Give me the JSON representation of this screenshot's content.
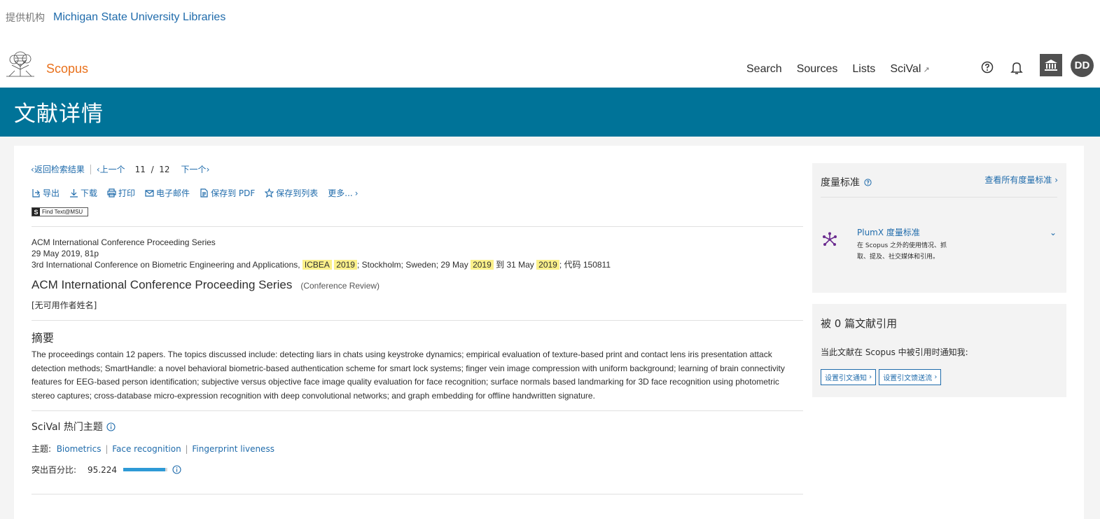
{
  "institution": {
    "label": "提供机构",
    "name": "Michigan State University Libraries"
  },
  "header": {
    "brand": "Scopus",
    "nav": [
      "Search",
      "Sources",
      "Lists",
      "SciVal"
    ],
    "nav_external_mark": "↗",
    "avatar_initials": "DD",
    "icons": [
      "help-icon",
      "bell-icon",
      "institution-icon"
    ]
  },
  "page_title": "文献详情",
  "breadcrumb": {
    "back": "返回检索结果",
    "prev": "上一个",
    "position": "11",
    "slash": "/",
    "total": "12",
    "next": "下一个"
  },
  "actions": [
    {
      "label": "导出",
      "icon": "export-icon"
    },
    {
      "label": "下载",
      "icon": "download-icon"
    },
    {
      "label": "打印",
      "icon": "print-icon"
    },
    {
      "label": "电子邮件",
      "icon": "email-icon"
    },
    {
      "label": "保存到 PDF",
      "icon": "pdf-icon"
    },
    {
      "label": "保存到列表",
      "icon": "star-icon"
    },
    {
      "label": "更多...",
      "icon": "chevron-right-icon"
    }
  ],
  "findtext": {
    "s": "S",
    "label": "Find Text@MSU"
  },
  "meta": {
    "series": "ACM International Conference Proceeding Series",
    "date_pages": "29 May 2019, 81p",
    "conf_prefix": "3rd International Conference on Biometric Engineering and Applications,",
    "hl_acronym": "ICBEA",
    "hl_year1": "2019",
    "conf_mid": "; Stockholm; Sweden; 29 May",
    "hl_year2": "2019",
    "conf_to": "到 31 May",
    "hl_year3": "2019",
    "conf_code": "; 代码 150811"
  },
  "document": {
    "title": "ACM International Conference Proceeding Series",
    "type": "(Conference Review)",
    "authors": "[无可用作者姓名]"
  },
  "abstract": {
    "heading": "摘要",
    "text": "The proceedings contain 12 papers. The topics discussed include: detecting liars in chats using keystroke dynamics; empirical evaluation of texture-based print and contact lens iris presentation attack detection methods; SmartHandle: a novel behavioral biometric-based authentication scheme for smart lock systems; finger vein image compression with uniform background; learning of brain connectivity features for EEG-based person identification; subjective versus objective face image quality evaluation for face recognition; surface normals based landmarking for 3D face recognition using photometric stereo captures; cross-database micro-expression recognition with deep convolutional networks; and graph embedding for offline handwritten signature."
  },
  "scival": {
    "heading": "SciVal 热门主题",
    "topic_label": "主题:",
    "topics": [
      "Biometrics",
      "Face recognition",
      "Fingerprint liveness"
    ],
    "topic_sep": "|",
    "prominence_label": "突出百分比:",
    "prominence_value": "95.224",
    "prominence_fraction": 0.95224
  },
  "metrics": {
    "heading": "度量标准",
    "view_all": "查看所有度量标准",
    "plumx_title": "PlumX 度量标准",
    "plumx_desc": "在 Scopus 之外的使用情况、抓取、提及、社交媒体和引用。"
  },
  "cited": {
    "heading": "被 0 篇文献引用",
    "desc": "当此文献在 Scopus 中被引用时通知我:",
    "btn1": "设置引文通知",
    "btn2": "设置引文馈送流"
  },
  "colors": {
    "band": "#007398",
    "link": "#1f6bab",
    "brand": "#e9711c",
    "highlight": "#fbf08a"
  }
}
